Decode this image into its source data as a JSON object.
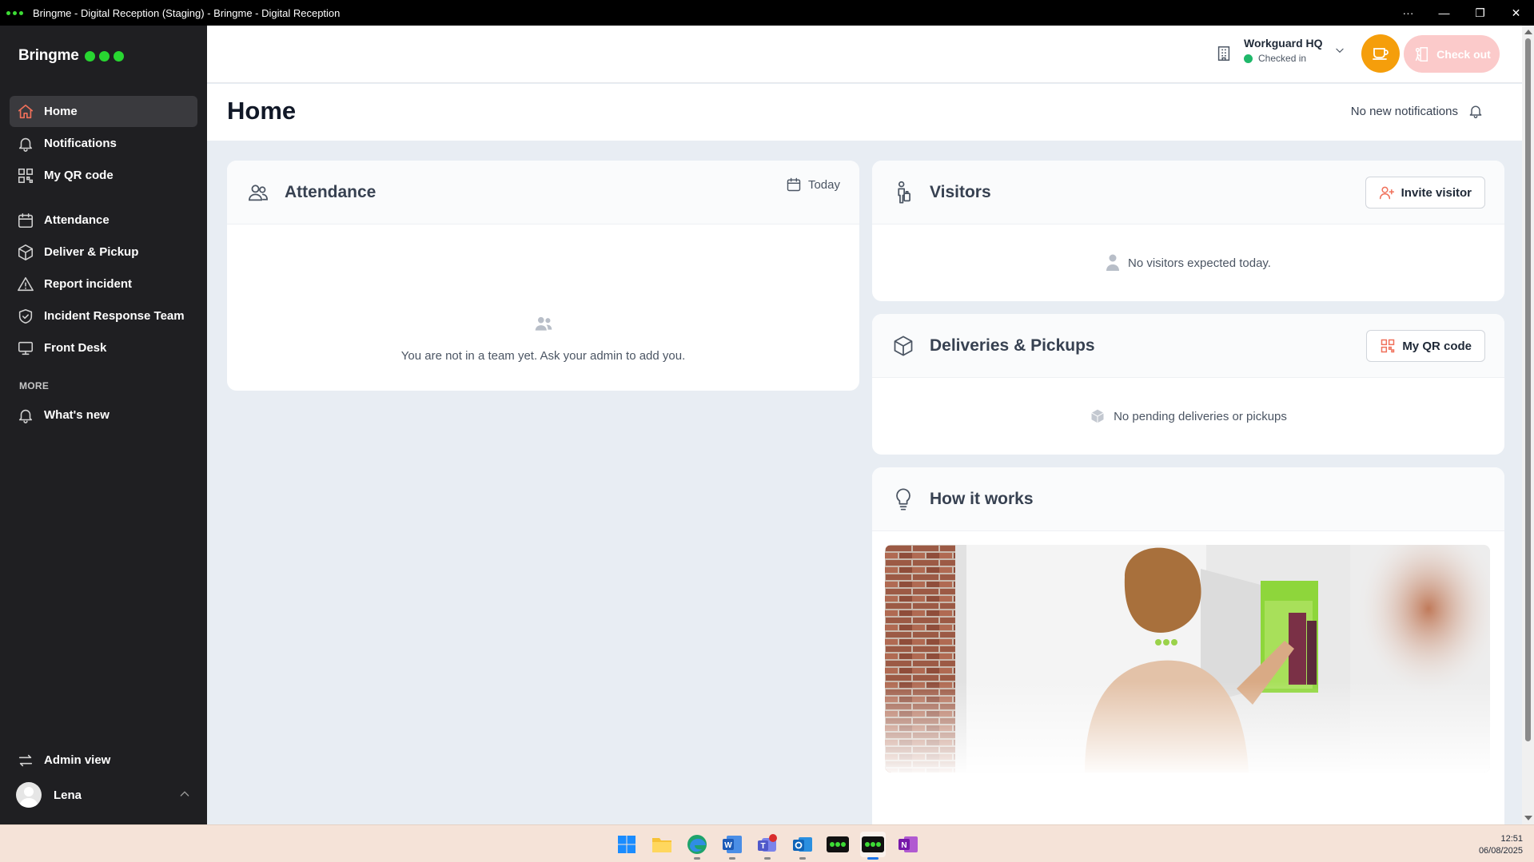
{
  "window": {
    "title": "Bringme - Digital Reception (Staging) - Bringme - Digital Reception",
    "controls": [
      "···",
      "—",
      "❐",
      "✕"
    ]
  },
  "sidebar": {
    "brand": "Bringme",
    "items": [
      {
        "label": "Home",
        "icon": "home-icon",
        "active": true
      },
      {
        "label": "Notifications",
        "icon": "bell-icon"
      },
      {
        "label": "My QR code",
        "icon": "qr-code-icon"
      },
      {
        "label": "Attendance",
        "icon": "calendar-icon"
      },
      {
        "label": "Deliver & Pickup",
        "icon": "package-icon"
      },
      {
        "label": "Report incident",
        "icon": "warning-icon"
      },
      {
        "label": "Incident Response Team",
        "icon": "shield-check-icon"
      },
      {
        "label": "Front Desk",
        "icon": "monitor-icon"
      }
    ],
    "more_label": "MORE",
    "more_items": [
      {
        "label": "What's new",
        "icon": "bell-icon"
      }
    ],
    "admin_view": "Admin view",
    "user_name": "Lena"
  },
  "topbar": {
    "location_name": "Workguard HQ",
    "location_status": "Checked in",
    "checkout_label": "Check out",
    "colors": {
      "coffee": "#f59e0b",
      "checkout": "#fbcaca",
      "status": "#1fb86a"
    }
  },
  "page": {
    "title": "Home",
    "notifications": "No new notifications"
  },
  "attendance": {
    "title": "Attendance",
    "filter": "Today",
    "empty": "You are not in a team yet. Ask your admin to add you."
  },
  "visitors": {
    "title": "Visitors",
    "button": "Invite visitor",
    "empty": "No visitors expected today."
  },
  "deliveries": {
    "title": "Deliveries & Pickups",
    "button": "My QR code",
    "empty": "No pending deliveries or pickups"
  },
  "how": {
    "title": "How it works"
  },
  "taskbar": {
    "apps": [
      "windows-start-icon",
      "file-explorer-icon",
      "edge-icon",
      "word-icon",
      "teams-icon",
      "outlook-icon",
      "bringme-icon",
      "bringme-staging-icon",
      "onenote-icon"
    ],
    "time": "12:51",
    "date": "06/08/2025"
  }
}
